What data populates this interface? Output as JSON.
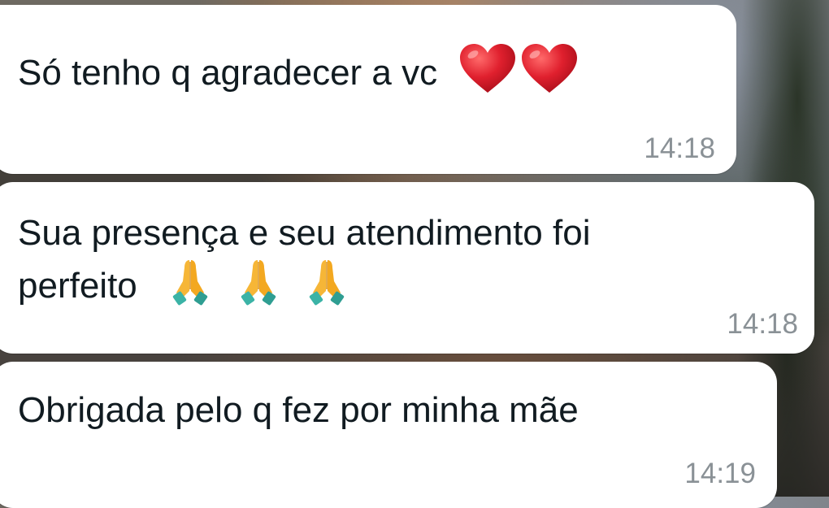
{
  "messages": [
    {
      "text": "Só tenho q agradecer a vc",
      "emojis": [
        "heart-icon",
        "heart-icon"
      ],
      "time": "14:18"
    },
    {
      "text_line1": "Sua presença e seu atendimento foi",
      "text_line2": "perfeito",
      "emojis": [
        "folded-hands-icon",
        "folded-hands-icon",
        "folded-hands-icon"
      ],
      "time": "14:18"
    },
    {
      "text": "Obrigada pelo q fez por minha mãe",
      "time": "14:19"
    }
  ],
  "colors": {
    "bubble": "#ffffff",
    "text": "#111b21",
    "timestamp": "#8a9196",
    "heart": "#e0202e",
    "hands": "#f6b637",
    "cuffs": "#3bb3a6"
  }
}
